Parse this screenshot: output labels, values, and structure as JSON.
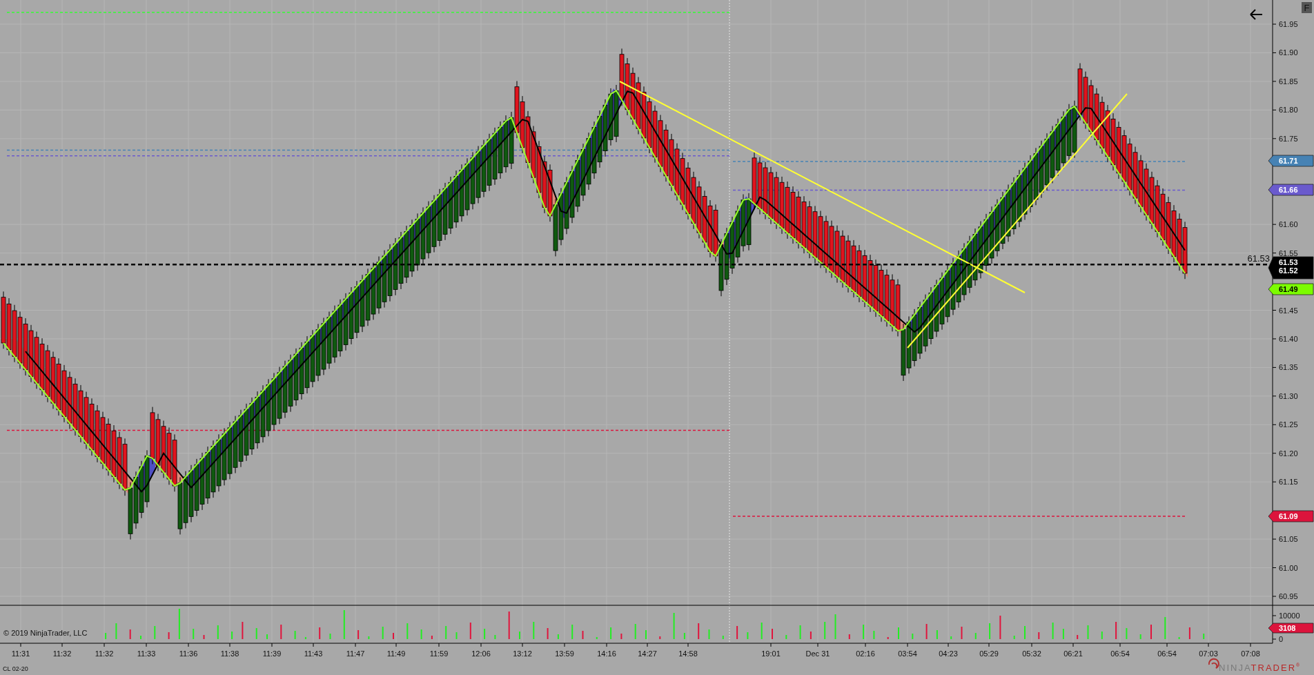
{
  "price_axis": {
    "ticks": [
      "61.95",
      "61.90",
      "61.85",
      "61.80",
      "61.75",
      "61.60",
      "61.55",
      "61.45",
      "61.40",
      "61.35",
      "61.30",
      "61.25",
      "61.20",
      "61.15",
      "61.05",
      "61.00",
      "60.95"
    ]
  },
  "price_markers": [
    {
      "labels": [
        "61.71"
      ],
      "color": "#4682b4"
    },
    {
      "labels": [
        "61.66"
      ],
      "color": "#6a5acd"
    },
    {
      "labels": [
        "61.53",
        "61.52"
      ],
      "color": "#000000"
    },
    {
      "labels": [
        "61.49"
      ],
      "color": "#7cfc00"
    },
    {
      "labels": [
        "61.09"
      ],
      "color": "#dc143c"
    }
  ],
  "last_price_label": "61.53",
  "volume_axis": {
    "ticks": [
      "10000",
      "0"
    ]
  },
  "volume_marker": {
    "label": "3108",
    "color": "#dc143c"
  },
  "time_axis": {
    "ticks": [
      "11:31",
      "11:32",
      "11:32",
      "11:33",
      "11:36",
      "11:38",
      "11:39",
      "11:43",
      "11:47",
      "11:49",
      "11:59",
      "12:06",
      "13:12",
      "13:59",
      "14:16",
      "14:27",
      "14:58",
      "19:01",
      "Dec 31",
      "02:16",
      "03:54",
      "04:23",
      "05:29",
      "05:32",
      "06:21",
      "06:54",
      "06:54",
      "07:03",
      "07:08"
    ]
  },
  "copyright": "© 2019 NinjaTrader, LLC",
  "instrument": "CL 02-20",
  "logo": {
    "first": "NINJA",
    "second": "TRADER",
    "mark": "®"
  },
  "float_button": "F"
}
